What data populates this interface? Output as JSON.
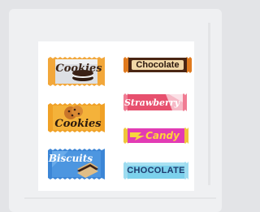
{
  "gallery": {
    "items": [
      {
        "label": "Cookies",
        "style": "orange-silver-wrapper",
        "color": "#f2a73a"
      },
      {
        "label": "Chocolate",
        "style": "brown-orange-wrapper",
        "color": "#4a2614"
      },
      {
        "label": "Cookies",
        "style": "orange-wrapper",
        "color": "#f0a126"
      },
      {
        "label": "Strawberry",
        "style": "pink-wrapper",
        "color": "#e7506e"
      },
      {
        "label": "Candy",
        "style": "magenta-yellow-wrapper",
        "color": "#e23bb4"
      },
      {
        "label": "Biscuits",
        "style": "blue-wrapper",
        "color": "#3c86d6"
      },
      {
        "label": "CHOCOLATE",
        "style": "light-blue-wrapper",
        "color": "#7cd1ec"
      }
    ]
  }
}
